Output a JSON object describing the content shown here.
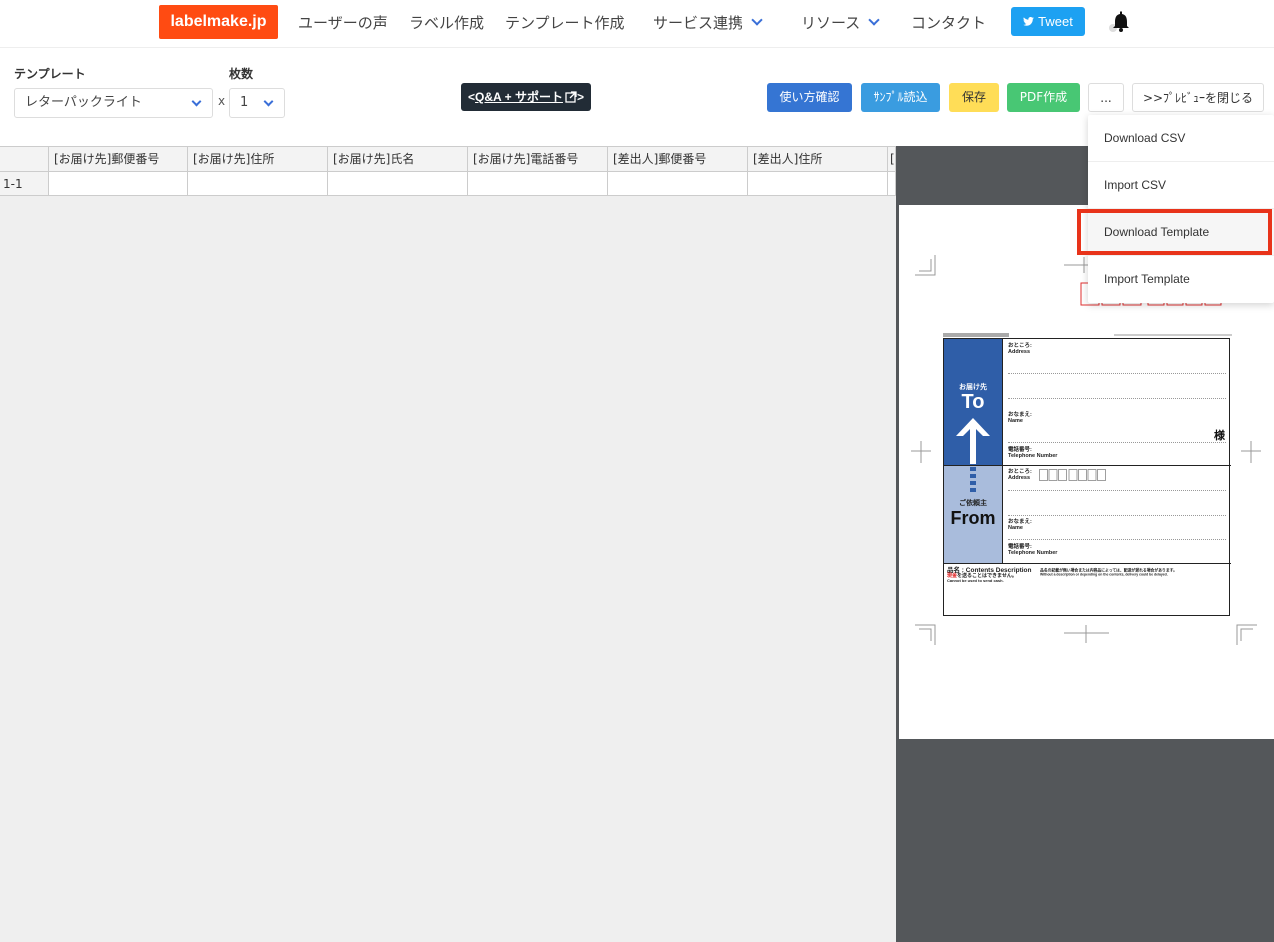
{
  "header": {
    "logo": "labelmake.jp",
    "nav": [
      "ユーザーの声",
      "ラベル作成",
      "テンプレート作成",
      "サービス連携",
      "リソース",
      "コンタクト"
    ],
    "tweet": "Tweet"
  },
  "toolbar": {
    "template_label": "テンプレート",
    "template_value": "レターパックライト",
    "count_label": "枚数",
    "times": "x",
    "count_value": "1",
    "qa_prefix": "<",
    "qa_text": "Q&A + サポート",
    "qa_suffix": ">",
    "buttons": {
      "howto": "使い方確認",
      "sample": "ｻﾝﾌﾟﾙ読込",
      "save": "保存",
      "pdf": "PDF作成",
      "more": "...",
      "close_preview": ">>ﾌﾟﾚﾋﾞｭｰを閉じる"
    }
  },
  "sheet": {
    "columns": [
      "[お届け先]郵便番号",
      "[お届け先]住所",
      "[お届け先]氏名",
      "[お届け先]電話番号",
      "[差出人]郵便番号",
      "[差出人]住所",
      "["
    ],
    "rows": [
      {
        "id": "1-1"
      }
    ]
  },
  "dropdown": {
    "items": [
      "Download CSV",
      "Import CSV",
      "Download Template",
      "Import Template"
    ]
  },
  "label": {
    "to_jp": "お届け先",
    "to_en": "To",
    "from_jp": "ご依頼主",
    "from_en": "From",
    "address_jp": "おところ:",
    "address_en": "Address",
    "name_jp": "おなまえ:",
    "name_en": "Name",
    "tel_jp": "電話番号:",
    "tel_en": "Telephone Number",
    "honorific": "様",
    "contents_jp": "品名 : Contents Description",
    "cash_note_red": "現金",
    "cash_note_rest": "を送ることはできません。",
    "cash_note_en": "Cannot be used to send cash.",
    "contents_note_jp": "品名の記載が無い場合または内容品によっては、配達が遅れる場合があります。",
    "contents_note_en": "Without a description or depending on the contents, delivery could be delayed."
  },
  "colors": {
    "logo": "#ff4b12",
    "howto": "#3575d3",
    "sample": "#3a9ce0",
    "save": "#ffdd57",
    "pdf": "#48c774",
    "highlight": "#e8331a",
    "label_blue": "#2f5ea8",
    "label_light_blue": "#a9bcdc"
  }
}
